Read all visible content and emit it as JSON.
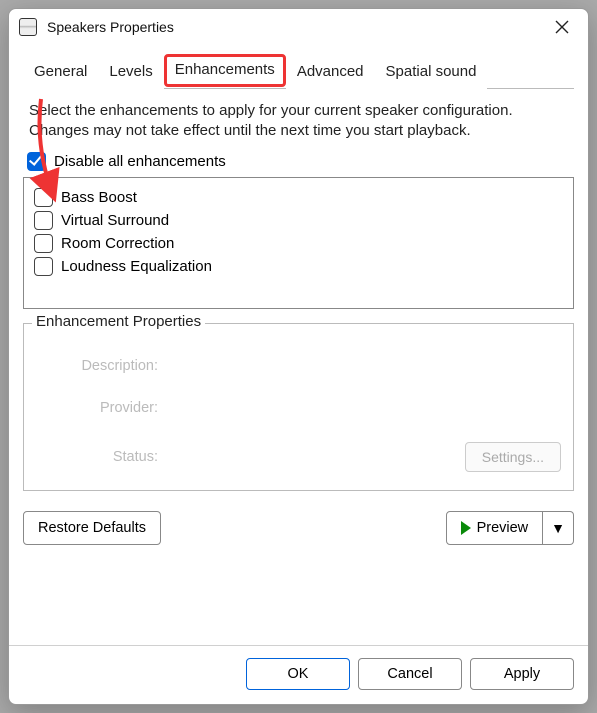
{
  "window": {
    "title": "Speakers Properties"
  },
  "tabs": {
    "general": "General",
    "levels": "Levels",
    "enhancements": "Enhancements",
    "advanced": "Advanced",
    "spatial": "Spatial sound"
  },
  "description": "Select the enhancements to apply for your current speaker configuration. Changes may not take effect until the next time you start playback.",
  "disable_all_label": "Disable all enhancements",
  "disable_all_checked": true,
  "enhancements": [
    "Bass Boost",
    "Virtual Surround",
    "Room Correction",
    "Loudness Equalization"
  ],
  "properties": {
    "group_title": "Enhancement Properties",
    "description_label": "Description:",
    "provider_label": "Provider:",
    "status_label": "Status:",
    "settings_button": "Settings..."
  },
  "actions": {
    "restore": "Restore Defaults",
    "preview": "Preview"
  },
  "footer": {
    "ok": "OK",
    "cancel": "Cancel",
    "apply": "Apply"
  },
  "annotation": {
    "tab_highlight": "enhancements",
    "arrow_target": "disable-all-checkbox"
  }
}
